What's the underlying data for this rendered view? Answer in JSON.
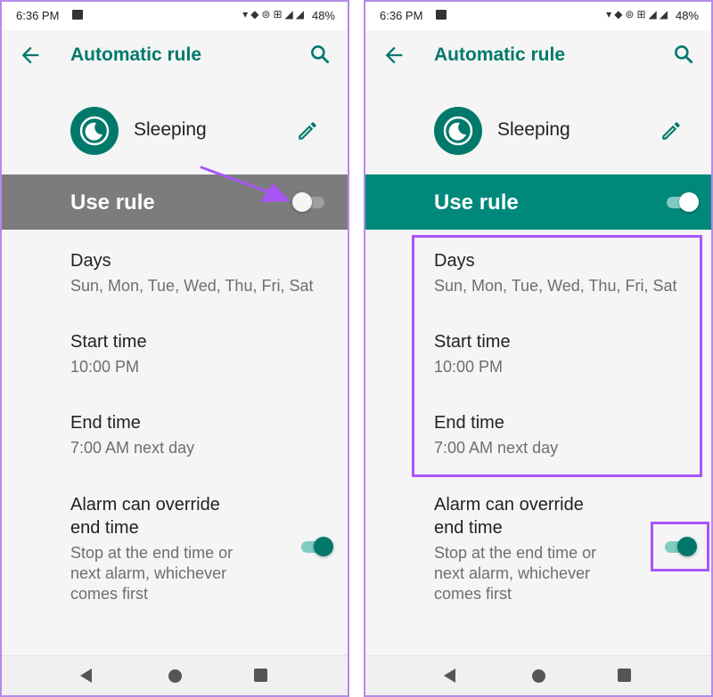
{
  "colors": {
    "accent": "#00796b",
    "toggle_off_bar": "#7c7c7c",
    "highlight": "#a855f7"
  },
  "panels": [
    {
      "status_bar": {
        "time": "6:36 PM",
        "icons": "▾◆⊚⊞◢◢",
        "battery": "48%"
      },
      "toolbar": {
        "title": "Automatic rule",
        "back_icon": "arrow-left-icon",
        "search_icon": "search-icon"
      },
      "rule": {
        "name": "Sleeping",
        "icon": "moon-clock-icon",
        "edit_icon": "pencil-icon"
      },
      "use_rule": {
        "label": "Use rule",
        "enabled": false
      },
      "settings": {
        "days": {
          "title": "Days",
          "value": "Sun, Mon, Tue, Wed, Thu, Fri, Sat"
        },
        "start": {
          "title": "Start time",
          "value": "10:00 PM"
        },
        "end": {
          "title": "End time",
          "value": "7:00 AM next day"
        },
        "alarm": {
          "title": "Alarm can override end time",
          "value": "Stop at the end time or next alarm, whichever comes first",
          "enabled": true
        }
      }
    },
    {
      "status_bar": {
        "time": "6:36 PM",
        "icons": "▾◆⊚⊞◢◢",
        "battery": "48%"
      },
      "toolbar": {
        "title": "Automatic rule",
        "back_icon": "arrow-left-icon",
        "search_icon": "search-icon"
      },
      "rule": {
        "name": "Sleeping",
        "icon": "moon-clock-icon",
        "edit_icon": "pencil-icon"
      },
      "use_rule": {
        "label": "Use rule",
        "enabled": true
      },
      "settings": {
        "days": {
          "title": "Days",
          "value": "Sun, Mon, Tue, Wed, Thu, Fri, Sat"
        },
        "start": {
          "title": "Start time",
          "value": "10:00 PM"
        },
        "end": {
          "title": "End time",
          "value": "7:00 AM next day"
        },
        "alarm": {
          "title": "Alarm can override end time",
          "value": "Stop at the end time or next alarm, whichever comes first",
          "enabled": true
        }
      }
    }
  ]
}
